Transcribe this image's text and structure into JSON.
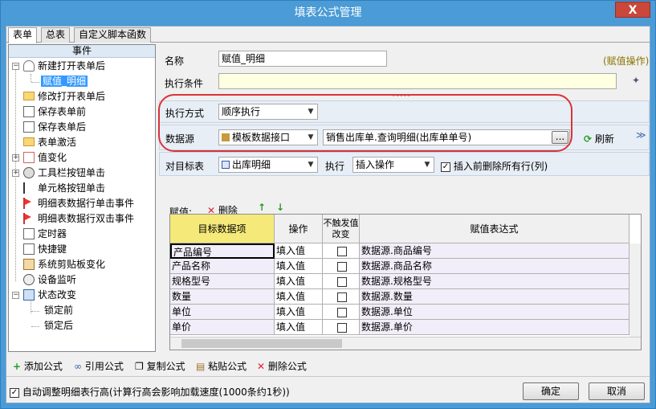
{
  "window": {
    "title": "填表公式管理",
    "close_label": "X"
  },
  "tabs": [
    "表单",
    "总表",
    "自定义脚本函数"
  ],
  "tree": {
    "header": "事件",
    "items": [
      {
        "label": "新建打开表单后"
      },
      {
        "label": "赋值_明细",
        "selected": true
      },
      {
        "label": "修改打开表单后"
      },
      {
        "label": "保存表单前"
      },
      {
        "label": "保存表单后"
      },
      {
        "label": "表单激活"
      },
      {
        "label": "值变化"
      },
      {
        "label": "工具栏按钮单击"
      },
      {
        "label": "单元格按钮单击"
      },
      {
        "label": "明细表数据行单击事件"
      },
      {
        "label": "明细表数据行双击事件"
      },
      {
        "label": "定时器"
      },
      {
        "label": "快捷键"
      },
      {
        "label": "系统剪贴板变化"
      },
      {
        "label": "设备监听"
      },
      {
        "label": "状态改变"
      },
      {
        "label": "锁定前"
      },
      {
        "label": "锁定后"
      }
    ]
  },
  "form": {
    "name_label": "名称",
    "name_value": "赋值_明细",
    "type_note": "(赋值操作)",
    "condition_label": "执行条件",
    "condition_value": "",
    "exec_mode_label": "执行方式",
    "exec_mode_value": "顺序执行",
    "source_label": "数据源",
    "source_type": "模板数据接口",
    "source_value": "销售出库单.查询明细(出库单单号)",
    "browse_label": "...",
    "refresh_label": "刷新",
    "target_label": "对目标表",
    "target_value": "出库明细",
    "exec_label": "执行",
    "exec_value": "插入操作",
    "delete_before_label": "插入前删除所有行(列)",
    "delete_before_checked": true
  },
  "assign": {
    "label": "赋值:",
    "delete_label": "删除",
    "columns": [
      "目标数据项",
      "操作",
      "不触发值改变",
      "赋值表达式"
    ],
    "rows": [
      {
        "target": "产品编号",
        "op": "填入值",
        "expr": "数据源.商品编号"
      },
      {
        "target": "产品名称",
        "op": "填入值",
        "expr": "数据源.商品名称"
      },
      {
        "target": "规格型号",
        "op": "填入值",
        "expr": "数据源.规格型号"
      },
      {
        "target": "数量",
        "op": "填入值",
        "expr": "数据源.数量"
      },
      {
        "target": "单位",
        "op": "填入值",
        "expr": "数据源.单位"
      },
      {
        "target": "单价",
        "op": "填入值",
        "expr": "数据源.单价"
      }
    ]
  },
  "actions": [
    "添加公式",
    "引用公式",
    "复制公式",
    "粘贴公式",
    "删除公式"
  ],
  "footer": {
    "auto_adjust_label": "自动调整明细表行高(计算行高会影响加载速度(1000条约1秒))",
    "auto_adjust_checked": true,
    "ok_label": "确定",
    "cancel_label": "取消"
  },
  "colors": {
    "title_bar": "#4a9bd6",
    "close": "#c9483b",
    "highlight": "#d9343a",
    "selected": "#3399ff",
    "grid_header_target": "#f5e97a"
  }
}
